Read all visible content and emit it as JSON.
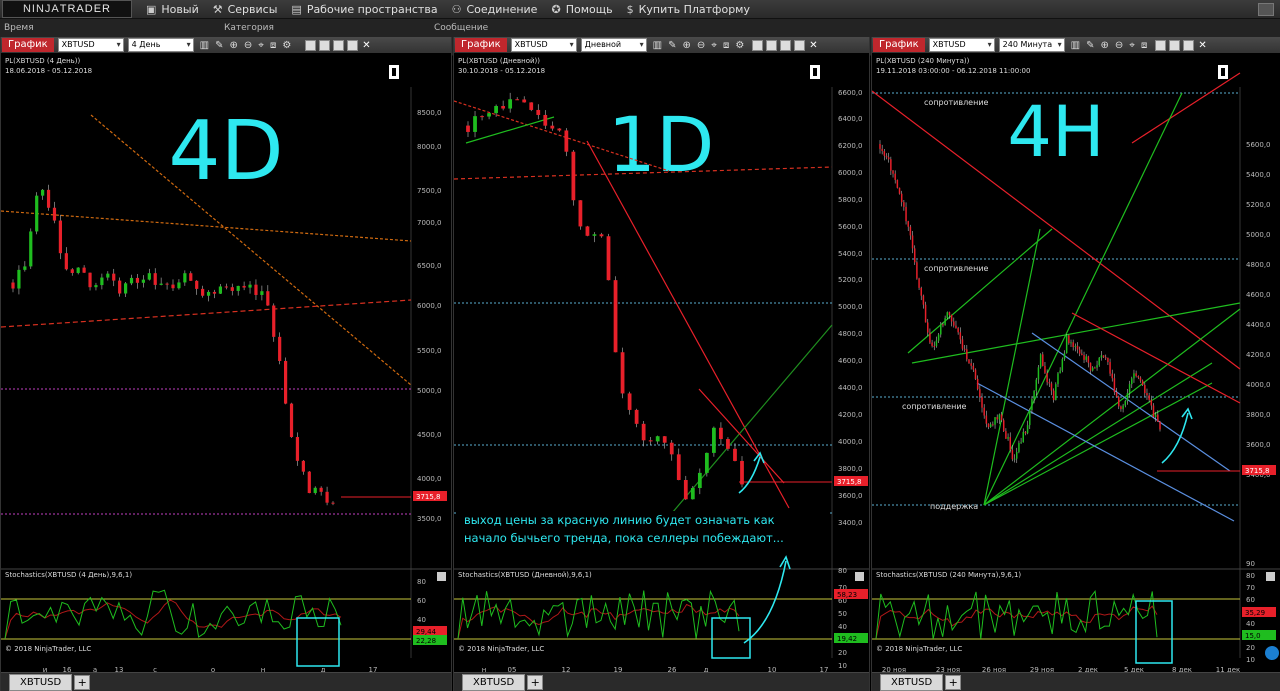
{
  "app": {
    "logo_left": "NINJA",
    "logo_right": "TRADER"
  },
  "menu": [
    {
      "label": "Новый",
      "icon": "new-icon"
    },
    {
      "label": "Сервисы",
      "icon": "tools-icon"
    },
    {
      "label": "Рабочие пространства",
      "icon": "workspace-icon"
    },
    {
      "label": "Соединение",
      "icon": "connection-icon"
    },
    {
      "label": "Помощь",
      "icon": "help-icon"
    },
    {
      "label": "Купить Платформу",
      "icon": "dollar-icon"
    }
  ],
  "log_headers": {
    "time": "Время",
    "category": "Категория",
    "message": "Сообщение"
  },
  "panes": [
    {
      "toolbar_label": "График",
      "instrument": "XBTUSD",
      "period": "4 День",
      "title": "PL(XBTUSD (4 День))",
      "date_range": "18.06.2018 - 05.12.2018",
      "big_label": "4D",
      "price_ticks": [
        "8500,0",
        "8000,0",
        "7500,0",
        "7000,0",
        "6500,0",
        "6000,0",
        "5500,0",
        "5000,0",
        "4500,0",
        "4000,0",
        "3500,0"
      ],
      "last_price": "3715,8",
      "indicator": "Stochastics(XBTUSD (4 День),9,6,1)",
      "stoch_ticks": [
        "80",
        "60",
        "40"
      ],
      "stoch_values": [
        "29,44",
        "22,28"
      ],
      "copyright": "© 2018 NinjaTrader, LLC",
      "x_ticks": [
        "и",
        "16",
        "а",
        "13",
        "с",
        "о",
        "н",
        "д",
        "17"
      ],
      "tab": "XBTUSD",
      "notes": []
    },
    {
      "toolbar_label": "График",
      "instrument": "XBTUSD",
      "period": "Дневной",
      "title": "PL(XBTUSD (Дневной))",
      "date_range": "30.10.2018 - 05.12.2018",
      "big_label": "1D",
      "price_ticks": [
        "6600,0",
        "6400,0",
        "6200,0",
        "6000,0",
        "5800,0",
        "5600,0",
        "5400,0",
        "5200,0",
        "5000,0",
        "4800,0",
        "4600,0",
        "4400,0",
        "4200,0",
        "4000,0",
        "3800,0",
        "3600,0",
        "3400,0"
      ],
      "last_price": "3715,8",
      "indicator": "Stochastics(XBTUSD (Дневной),9,6,1)",
      "stoch_ticks": [
        "80",
        "70",
        "60",
        "50",
        "40",
        "30",
        "20",
        "10"
      ],
      "stoch_values": [
        "58,23",
        "19,42"
      ],
      "copyright": "© 2018 NinjaTrader, LLC",
      "x_ticks": [
        "н",
        "05",
        "12",
        "19",
        "26",
        "д",
        "10",
        "17"
      ],
      "tab": "XBTUSD",
      "notes": [
        "выход цены за красную линию будет означать как",
        "начало бычьего тренда, пока селлеры побеждают..."
      ]
    },
    {
      "toolbar_label": "График",
      "instrument": "XBTUSD",
      "period": "240 Минута",
      "title": "PL(XBTUSD (240 Минута))",
      "date_range": "19.11.2018 03:00:00 - 06.12.2018 11:00:00",
      "big_label": "4H",
      "price_ticks": [
        "5600,0",
        "5400,0",
        "5200,0",
        "5000,0",
        "4800,0",
        "4600,0",
        "4400,0",
        "4200,0",
        "4000,0",
        "3800,0",
        "3600,0",
        "3400,0"
      ],
      "last_price": "3715,8",
      "indicator": "Stochastics(XBTUSD (240 Минута),9,6,1)",
      "stoch_ticks": [
        "90",
        "80",
        "70",
        "60",
        "50",
        "40",
        "30",
        "20",
        "10"
      ],
      "stoch_values": [
        "35,29",
        "15,0"
      ],
      "copyright": "© 2018 NinjaTrader, LLC",
      "x_ticks": [
        "20 ноя",
        "23 ноя",
        "26 ноя",
        "29 ноя",
        "2 дек",
        "5 дек",
        "8 дек",
        "11 дек"
      ],
      "tab": "XBTUSD",
      "notes": [
        "сопротивление",
        "сопротивление",
        "сопротивление",
        "поддержка"
      ]
    }
  ],
  "colors": {
    "up": "#1fbd1f",
    "down": "#e8202a",
    "label": "#2ee8f0",
    "stoch_k": "#1fbd1f",
    "stoch_d": "#b01818",
    "bg": "#000000",
    "tab_red": "#c0272d"
  }
}
